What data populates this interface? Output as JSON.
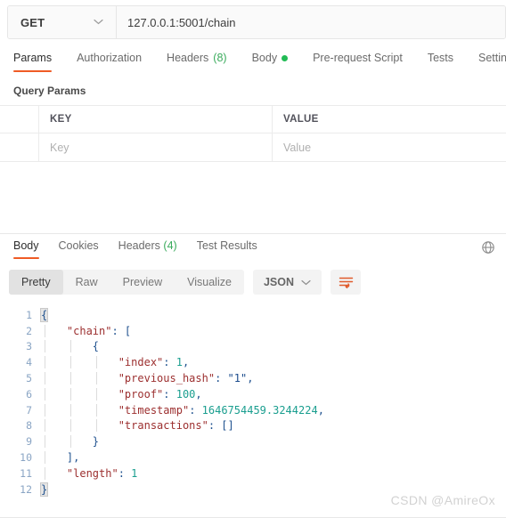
{
  "request": {
    "method": "GET",
    "method_dropdown_icon": "chevron-down-icon",
    "url": "127.0.0.1:5001/chain",
    "tabs": [
      {
        "label": "Params",
        "active": true
      },
      {
        "label": "Authorization",
        "active": false
      },
      {
        "label": "Headers",
        "count": "(8)",
        "active": false
      },
      {
        "label": "Body",
        "badge": "dot",
        "active": false
      },
      {
        "label": "Pre-request Script",
        "active": false
      },
      {
        "label": "Tests",
        "active": false
      },
      {
        "label": "Settings",
        "active": false
      }
    ],
    "query_params": {
      "title": "Query Params",
      "columns": [
        "KEY",
        "VALUE"
      ],
      "rows": [
        {
          "key_placeholder": "Key",
          "value_placeholder": "Value"
        }
      ]
    }
  },
  "response": {
    "tabs": [
      {
        "label": "Body",
        "active": true
      },
      {
        "label": "Cookies",
        "active": false
      },
      {
        "label": "Headers",
        "count": "(4)",
        "active": false
      },
      {
        "label": "Test Results",
        "active": false
      }
    ],
    "globe_icon": "globe-icon",
    "view_modes": [
      {
        "label": "Pretty",
        "active": true
      },
      {
        "label": "Raw",
        "active": false
      },
      {
        "label": "Preview",
        "active": false
      },
      {
        "label": "Visualize",
        "active": false
      }
    ],
    "format": "JSON",
    "format_dropdown_icon": "chevron-down-icon",
    "wrap_icon": "wrap-text-icon",
    "body_json": {
      "chain": [
        {
          "index": 1,
          "previous_hash": "1",
          "proof": 100,
          "timestamp": 1646754459.3244224,
          "transactions": []
        }
      ],
      "length": 1
    },
    "code_lines": [
      {
        "n": "1",
        "text": "{"
      },
      {
        "n": "2",
        "text": "    \"chain\": ["
      },
      {
        "n": "3",
        "text": "        {"
      },
      {
        "n": "4",
        "text": "            \"index\": 1,"
      },
      {
        "n": "5",
        "text": "            \"previous_hash\": \"1\","
      },
      {
        "n": "6",
        "text": "            \"proof\": 100,"
      },
      {
        "n": "7",
        "text": "            \"timestamp\": 1646754459.3244224,"
      },
      {
        "n": "8",
        "text": "            \"transactions\": []"
      },
      {
        "n": "9",
        "text": "        }"
      },
      {
        "n": "10",
        "text": "    },"
      },
      {
        "n": "11",
        "text": "    \"length\": 1"
      },
      {
        "n": "12",
        "text": "}"
      }
    ]
  },
  "watermark": "CSDN @AmireOx",
  "colors": {
    "accent": "#ef5b25",
    "green": "#22bb55",
    "count_green": "#3aab5c",
    "json_key": "#9c2f2f",
    "json_string": "#1a4b8c",
    "json_number": "#1a9e8f",
    "json_punct": "#20528f",
    "line_number": "#8aa5c4"
  }
}
